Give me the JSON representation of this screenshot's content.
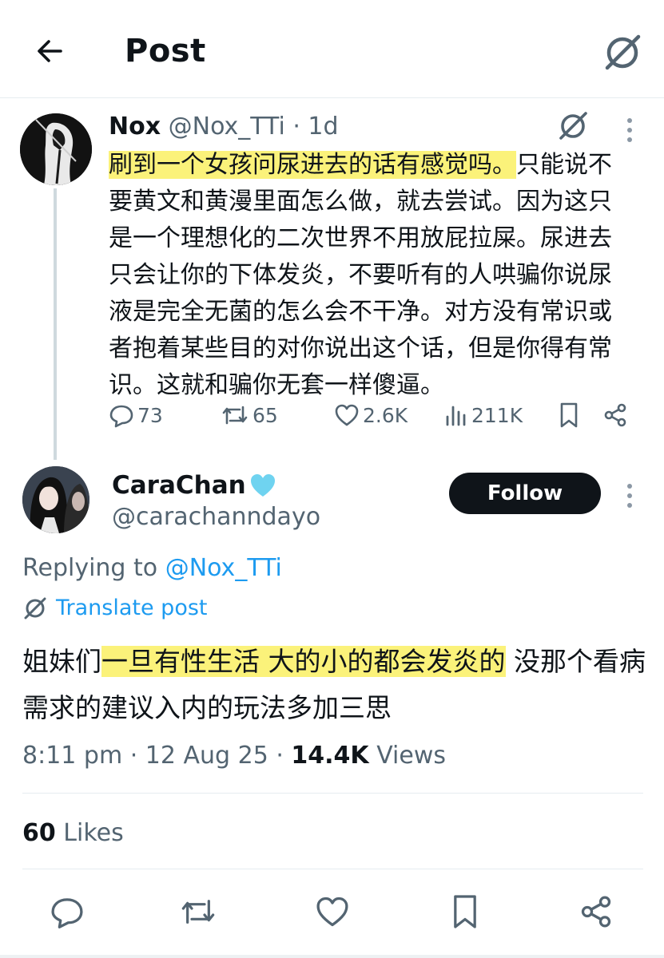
{
  "header": {
    "title": "Post"
  },
  "parent_post": {
    "display_name": "Nox",
    "handle": "@Nox_TTi",
    "time": "· 1d",
    "text_highlight": "刷到一个女孩问尿进去的话有感觉吗。",
    "text_rest": "只能说不要黄文和黄漫里面怎么做，就去尝试。因为这只是一个理想化的二次世界不用放屁拉屎。尿进去只会让你的下体发炎，不要听有的人哄骗你说尿液是完全无菌的怎么会不干净。对方没有常识或者抱着某些目的对你说出这个话，但是你得有常识。这就和骗你无套一样傻逼。",
    "stats": {
      "replies": "73",
      "reposts": "65",
      "likes": "2.6K",
      "views": "211K"
    }
  },
  "reply_post": {
    "display_name": "CaraChan",
    "handle": "@carachanndayo",
    "follow_label": "Follow",
    "replying_prefix": "Replying to",
    "replying_handle": "@Nox_TTi",
    "translate_label": "Translate post",
    "text_pre": "姐妹们",
    "text_highlight": "一旦有性生活 大的小的都会发炎的",
    "text_post": "没那个看病需求的建议入内的玩法多加三思",
    "time": "8:11 pm · 12 Aug 25 · ",
    "views_count": "14.4K",
    "views_label": " Views",
    "likes_count": "60",
    "likes_label": " Likes"
  },
  "colors": {
    "accent": "#1d9bf0",
    "highlight": "#fbf27a",
    "muted": "#536471",
    "heart_emoji": "#6fd3f0"
  },
  "icons": [
    "back-arrow-icon",
    "grok-icon",
    "more-vertical-icon",
    "reply-icon",
    "repost-icon",
    "like-icon",
    "views-icon",
    "bookmark-icon",
    "share-icon",
    "blue-heart-icon"
  ]
}
